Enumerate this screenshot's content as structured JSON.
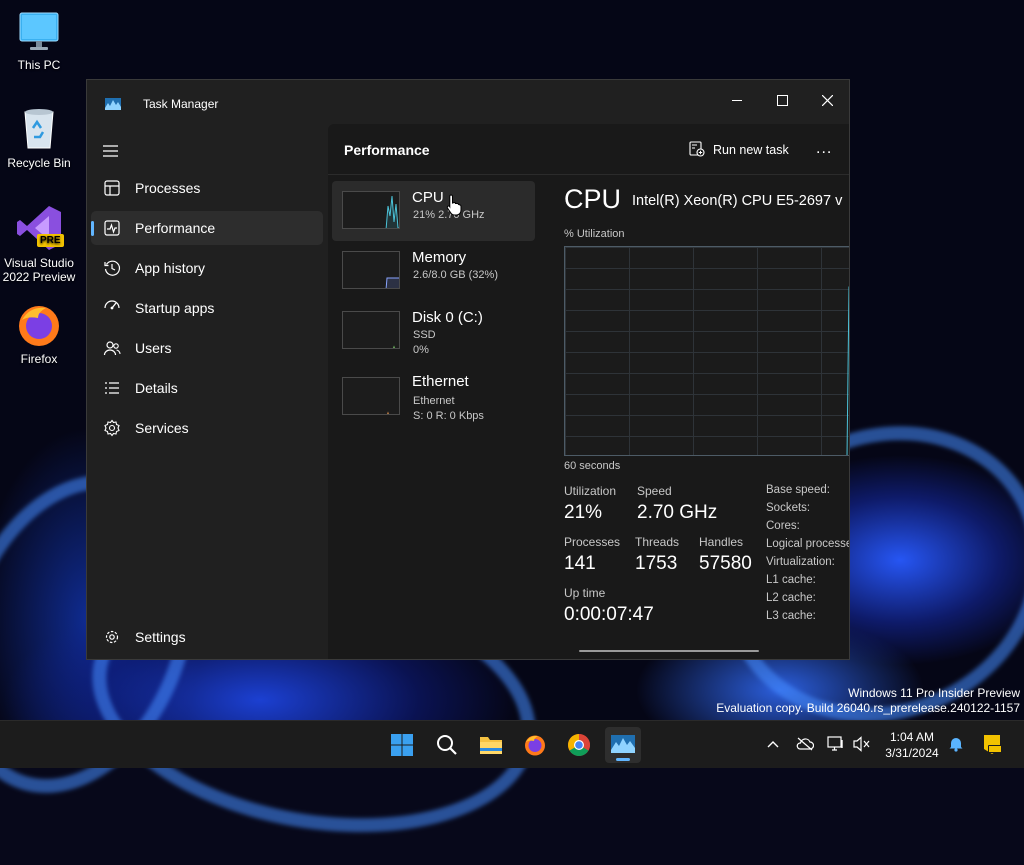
{
  "desktop": {
    "icons": [
      {
        "label": "This PC"
      },
      {
        "label": "Recycle Bin"
      },
      {
        "label_line1": "Visual Studio",
        "label_line2": "2022 Preview",
        "badge": "PRE"
      },
      {
        "label": "Firefox"
      }
    ],
    "watermark": {
      "line1": "Windows 11 Pro Insider Preview",
      "line2": "Evaluation copy. Build 26040.rs_prerelease.240122-1157"
    }
  },
  "window": {
    "title": "Task Manager",
    "controls": {
      "minimize": "minimize-icon",
      "maximize": "maximize-icon",
      "close": "close-icon"
    }
  },
  "sidebar": {
    "items": [
      {
        "label": "Processes",
        "icon": "processes-icon"
      },
      {
        "label": "Performance",
        "icon": "performance-icon",
        "active": true
      },
      {
        "label": "App history",
        "icon": "history-icon"
      },
      {
        "label": "Startup apps",
        "icon": "startup-icon"
      },
      {
        "label": "Users",
        "icon": "users-icon"
      },
      {
        "label": "Details",
        "icon": "details-icon"
      },
      {
        "label": "Services",
        "icon": "services-icon"
      }
    ],
    "settings_label": "Settings"
  },
  "main": {
    "title": "Performance",
    "run_new_task": "Run new task",
    "more": "..."
  },
  "perf_list": [
    {
      "name": "CPU",
      "sub1": "21% 2.70 GHz",
      "active": true
    },
    {
      "name": "Memory",
      "sub1": "2.6/8.0 GB (32%)"
    },
    {
      "name": "Disk 0 (C:)",
      "sub1": "SSD",
      "sub2": "0%"
    },
    {
      "name": "Ethernet",
      "sub1": "Ethernet",
      "sub2": "S: 0 R: 0 Kbps"
    }
  ],
  "detail": {
    "title": "CPU",
    "model": "Intel(R) Xeon(R) CPU E5-2697 v",
    "graph_label": "% Utilization",
    "graph_time": "60 seconds",
    "stats": {
      "utilization_label": "Utilization",
      "utilization_value": "21%",
      "speed_label": "Speed",
      "speed_value": "2.70 GHz",
      "processes_label": "Processes",
      "processes_value": "141",
      "threads_label": "Threads",
      "threads_value": "1753",
      "handles_label": "Handles",
      "handles_value": "57580",
      "uptime_label": "Up time",
      "uptime_value": "0:00:07:47"
    },
    "specs": [
      "Base speed:",
      "Sockets:",
      "Cores:",
      "Logical processe",
      "Virtualization:",
      "L1 cache:",
      "L2 cache:",
      "L3 cache:"
    ]
  },
  "taskbar": {
    "apps": [
      "start-icon",
      "search-icon",
      "file-explorer-icon",
      "firefox-icon",
      "chrome-icon",
      "task-manager-icon"
    ],
    "clock_time": "1:04 AM",
    "clock_date": "3/31/2024"
  },
  "colors": {
    "accent": "#62b6ff",
    "window_bg": "#202020",
    "main_bg": "#191919",
    "cpu_line": "#4cc3d9"
  }
}
